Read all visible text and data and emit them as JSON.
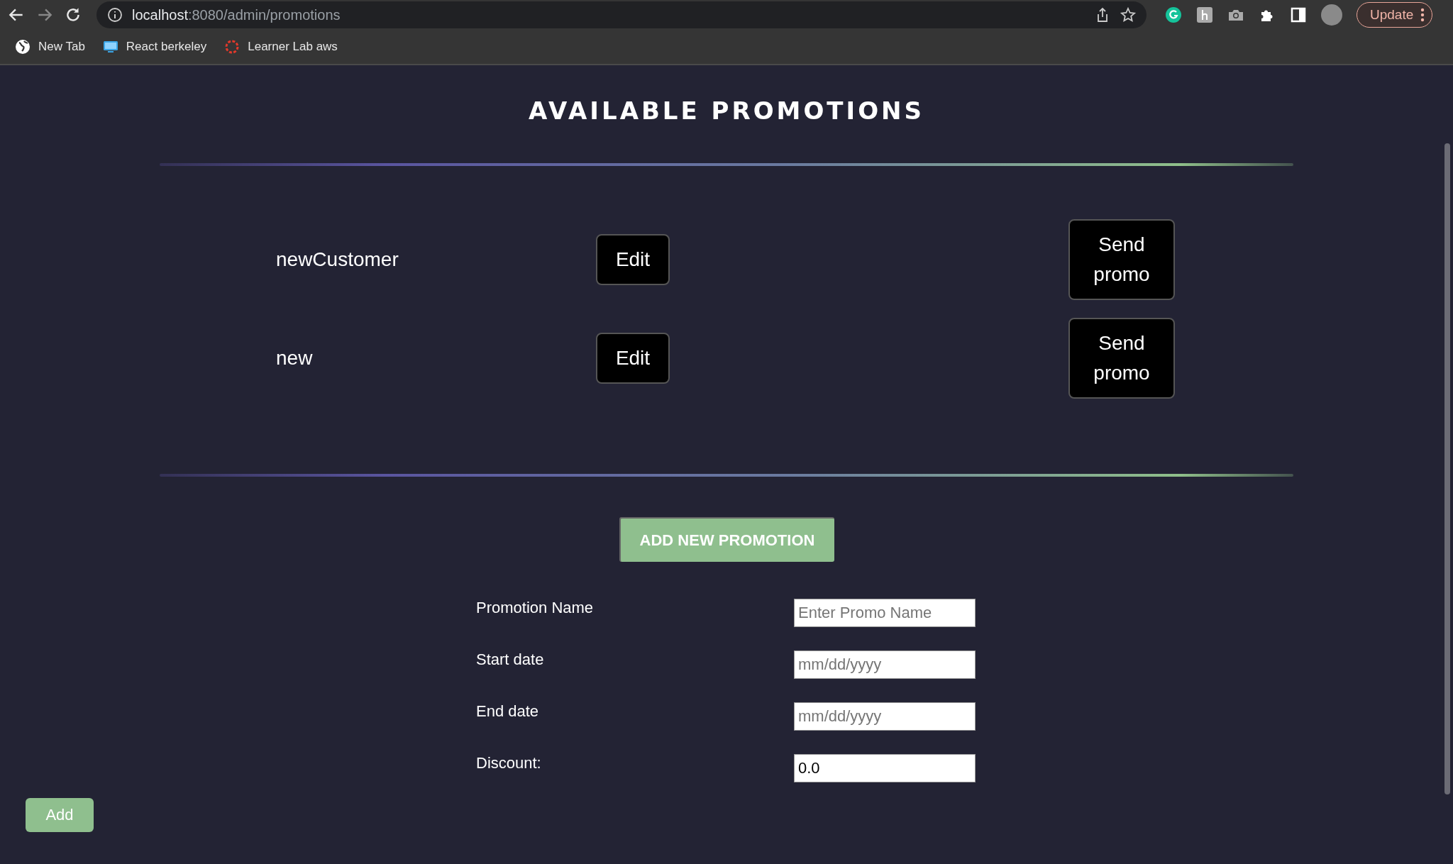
{
  "browser": {
    "url_host": "localhost",
    "url_path": ":8080/admin/promotions",
    "update_button": "Update",
    "bookmarks": [
      {
        "label": "New Tab",
        "kind": "globe"
      },
      {
        "label": "React berkeley",
        "kind": "monitor"
      },
      {
        "label": "Learner Lab aws",
        "kind": "ring"
      }
    ]
  },
  "page": {
    "title": "AVAILABLE PROMOTIONS",
    "promotions": [
      {
        "name": "newCustomer",
        "edit_button": "Edit",
        "send_button": "Send promo"
      },
      {
        "name": "new",
        "edit_button": "Edit",
        "send_button": "Send promo"
      }
    ],
    "add_new_button": "ADD NEW PROMOTION",
    "form": {
      "fields": [
        {
          "label": "Promotion Name",
          "placeholder": "Enter Promo Name"
        },
        {
          "label": "Start date",
          "placeholder": "mm/dd/yyyy"
        },
        {
          "label": "End date",
          "placeholder": "mm/dd/yyyy"
        },
        {
          "label": "Discount:",
          "value": "0.0"
        }
      ],
      "submit_button": "Add"
    }
  }
}
